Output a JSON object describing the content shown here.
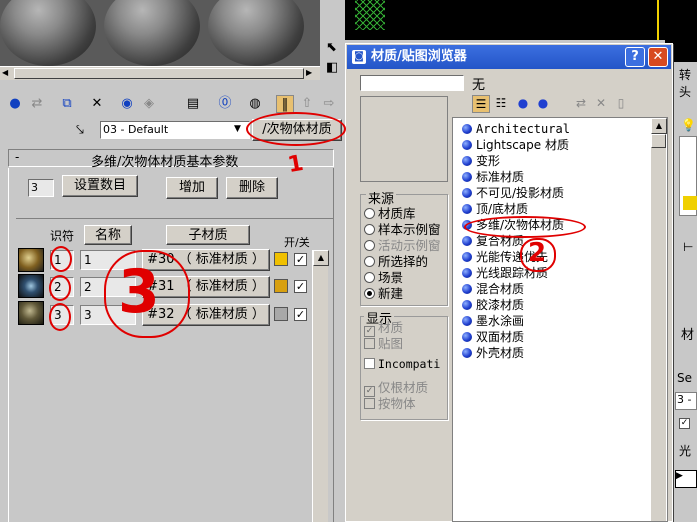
{
  "left_panel": {
    "material_name": "03 - Default",
    "type_button": "/次物体材质",
    "rollout_title": "多维/次物体材质基本参数",
    "count_value": "3",
    "set_number_button": "设置数目",
    "add_button": "增加",
    "delete_button": "删除",
    "col_id": "识符",
    "col_name": "名称",
    "col_submat": "子材质",
    "col_onoff": "开/关",
    "rows": [
      {
        "id": "1",
        "name": "1",
        "submat": "#30 （ 标准材质 ）",
        "swatch": "#f0c000"
      },
      {
        "id": "2",
        "name": "2",
        "submat": "#31 （ 标准材质 ）",
        "swatch": "#d8a010"
      },
      {
        "id": "3",
        "name": "3",
        "submat": "#32 （ 标准材质 ）",
        "swatch": "#a8a8a8"
      }
    ]
  },
  "dialog": {
    "title": "材质/贴图浏览器",
    "help": "?",
    "close": "✕",
    "name_label": "无",
    "source_label": "来源",
    "source_options": [
      "材质库",
      "样本示例窗",
      "活动示例窗",
      "所选择的",
      "场景",
      "新建"
    ],
    "display_label": "显示",
    "display_options": [
      "材质",
      "贴图",
      "Incompati"
    ],
    "other_options": [
      "仅根材质",
      "按物体"
    ],
    "materials": [
      "Architectural",
      "Lightscape 材质",
      "变形",
      "标准材质",
      "不可见/投影材质",
      "顶/底材质",
      "多维/次物体材质",
      "复合材质",
      "光能传递优先",
      "光线跟踪材质",
      "混合材质",
      "胶漆材质",
      "墨水涂画",
      "双面材质",
      "外壳材质"
    ]
  },
  "right_strip": {
    "t1": "转头",
    "t2": "材",
    "t3": "Se",
    "t4": "3 -",
    "t5": "光"
  },
  "annotations": {
    "n1": "1",
    "n2": "2",
    "n3": "3"
  },
  "colors": {
    "title_bar": "#2455c8",
    "annotation_red": "#e00000"
  }
}
